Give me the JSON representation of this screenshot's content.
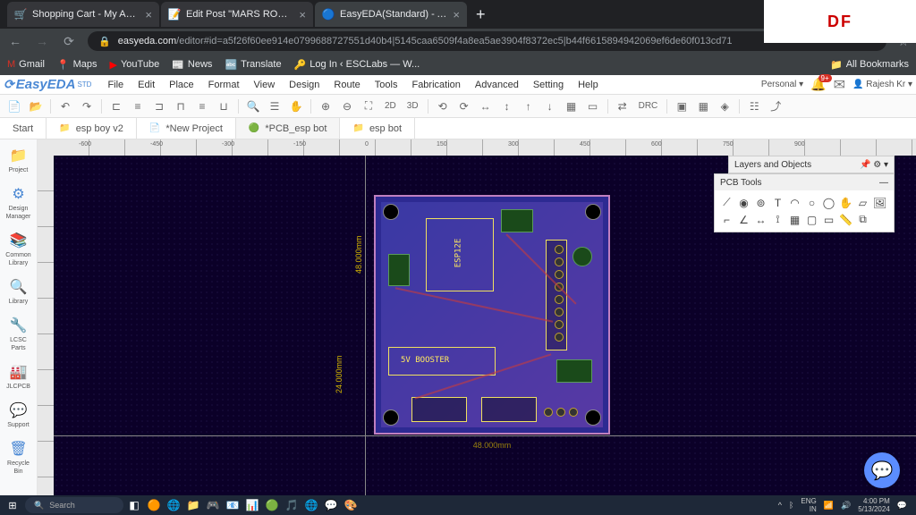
{
  "browser": {
    "tabs": [
      {
        "icon": "🛒",
        "title": "Shopping Cart - My Account - PCB"
      },
      {
        "icon": "📝",
        "title": "Edit Post \"MARS ROVER USING N..."
      },
      {
        "icon": "🔵",
        "title": "EasyEDA(Standard) - A Simple and",
        "active": true
      }
    ],
    "url_domain": "easyeda.com",
    "url_path": "/editor#id=a5f26f60ee914e0799688727551d40b4|5145caa6509f4a8ea5ae3904f8372ec5|b44f6615894942069ef6de60f013cd71"
  },
  "right_badge": "DF",
  "bookmarks": [
    {
      "icon": "M",
      "label": "Gmail",
      "color": "#d93025"
    },
    {
      "icon": "📍",
      "label": "Maps"
    },
    {
      "icon": "▶",
      "label": "YouTube",
      "color": "#ff0000"
    },
    {
      "icon": "📰",
      "label": "News"
    },
    {
      "icon": "🔤",
      "label": "Translate"
    },
    {
      "icon": "🔑",
      "label": "Log In ‹ ESCLabs — W..."
    }
  ],
  "all_bookmarks": "All Bookmarks",
  "app_name": "EasyEDA",
  "app_edition": "STD",
  "menus": [
    "File",
    "Edit",
    "Place",
    "Format",
    "View",
    "Design",
    "Route",
    "Tools",
    "Fabrication",
    "Advanced",
    "Setting",
    "Help"
  ],
  "account": {
    "plan": "Personal",
    "notif": "9+",
    "user": "Rajesh Kr"
  },
  "toolbar_2d": "2D",
  "toolbar_3d": "3D",
  "toolbar_drc": "DRC",
  "doc_tabs": [
    {
      "label": "Start"
    },
    {
      "icon": "📁",
      "label": "esp boy v2"
    },
    {
      "icon": "📄",
      "label": "*New Project"
    },
    {
      "icon": "🟢",
      "label": "*PCB_esp bot",
      "active": true
    },
    {
      "icon": "📁",
      "label": "esp bot"
    }
  ],
  "sidebar": [
    {
      "icon": "📁",
      "label": "Project"
    },
    {
      "icon": "⚙",
      "label": "Design Manager"
    },
    {
      "icon": "📚",
      "label": "Common Library"
    },
    {
      "icon": "🔍",
      "label": "Library"
    },
    {
      "icon": "🔧",
      "label": "LCSC Parts"
    },
    {
      "icon": "🏭",
      "label": "JLCPCB"
    },
    {
      "icon": "💬",
      "label": "Support"
    },
    {
      "icon": "🗑",
      "label": "Recycle Bin"
    }
  ],
  "dimensions": {
    "height": "48.000mm",
    "half_height": "24.000mm",
    "width": "48.000mm"
  },
  "pcb_labels": {
    "board_name": "ESP12E",
    "booster": "5V BOOSTER"
  },
  "panels": {
    "layers": "Layers and Objects",
    "tools": "PCB Tools"
  },
  "taskbar": {
    "search": "Search",
    "lang": "ENG",
    "lang_sub": "IN",
    "time": "4:00 PM",
    "date": "5/13/2024"
  }
}
